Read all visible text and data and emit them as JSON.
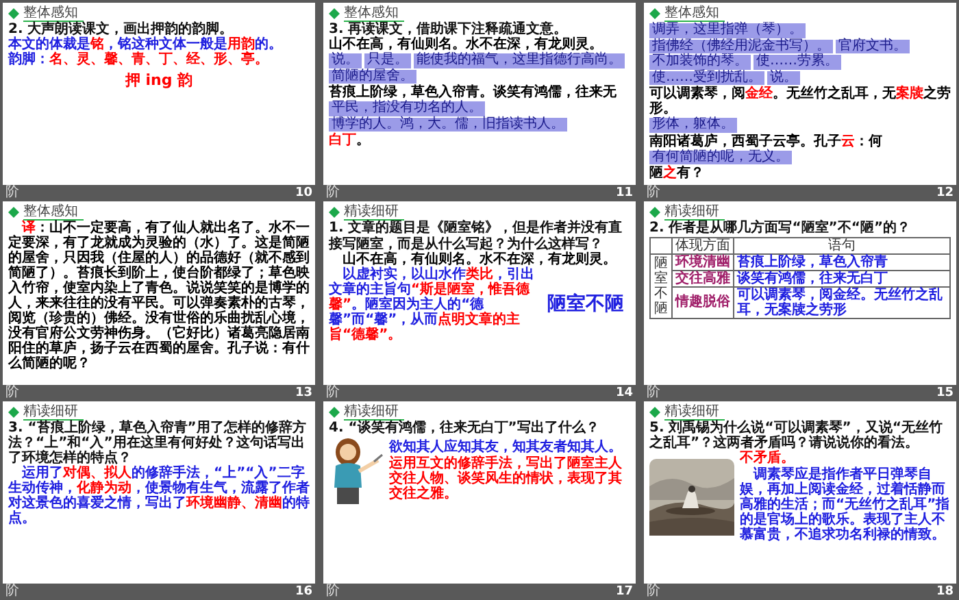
{
  "slides": [
    {
      "number": "10",
      "mark": "阶",
      "section": "整体感知",
      "blocks": [
        {
          "kind": "heading",
          "text": "2. 大声朗读课文，画出押韵的韵脚。"
        },
        {
          "kind": "para",
          "segments": [
            {
              "text": "本文的体裁是",
              "color": "#2020e0"
            },
            {
              "text": "铭",
              "color": "#ff0000"
            },
            {
              "text": "，铭这种文体一般是",
              "color": "#2020e0"
            },
            {
              "text": "用韵",
              "color": "#ff0000"
            },
            {
              "text": "的。",
              "color": "#2020e0"
            }
          ]
        },
        {
          "kind": "para",
          "segments": [
            {
              "text": "韵脚：",
              "color": "#2020e0"
            },
            {
              "text": "名、灵、馨、青、丁、经、形、亭。",
              "color": "#ff0000"
            }
          ]
        },
        {
          "kind": "callout",
          "text": "押 ing 韵",
          "color": "#ff0000"
        }
      ]
    },
    {
      "number": "11",
      "mark": "阶",
      "section": "整体感知",
      "blocks": [
        {
          "kind": "heading",
          "text": "3. 再读课文，借助课下注释疏通文意。"
        },
        {
          "kind": "para",
          "segments": [
            {
              "text": "山不在高，有仙则名。水不在深，有龙则灵。",
              "color": "#000000"
            }
          ]
        },
        {
          "kind": "tags",
          "items": [
            "说。",
            "只是。",
            "能使我的福气，这里指德行高尚。",
            "简陋的屋舍。"
          ]
        },
        {
          "kind": "para",
          "segments": [
            {
              "text": "苔痕上阶绿，草色入帘青。谈笑有鸿儒，往来无",
              "color": "#000000"
            }
          ]
        },
        {
          "kind": "tags",
          "items": [
            "平民，指没有功名的人。",
            "博学的人。鸿，大。儒，旧指读书人。"
          ]
        },
        {
          "kind": "para",
          "segments": [
            {
              "text": "白丁",
              "color": "#ff0000"
            },
            {
              "text": "。",
              "color": "#000000"
            }
          ]
        }
      ]
    },
    {
      "number": "12",
      "mark": "阶",
      "section": "整体感知",
      "blocks": [
        {
          "kind": "tags",
          "items": [
            "调弄，这里指弹（琴）。",
            "指佛经（佛经用泥金书写）。",
            "官府文书。",
            "不加装饰的琴。",
            "使……劳累。",
            "使……受到扰乱。",
            "说。"
          ]
        },
        {
          "kind": "para",
          "segments": [
            {
              "text": "可以调素琴，阅",
              "color": "#000000"
            },
            {
              "text": "金经",
              "color": "#ff0000"
            },
            {
              "text": "。无丝竹之乱耳，无",
              "color": "#000000"
            },
            {
              "text": "案牍",
              "color": "#ff0000"
            },
            {
              "text": "之劳形。",
              "color": "#000000"
            }
          ]
        },
        {
          "kind": "tags",
          "items": [
            "形体，躯体。"
          ]
        },
        {
          "kind": "para",
          "segments": [
            {
              "text": "南阳诸葛庐，西蜀子云亭。孔子",
              "color": "#000000"
            },
            {
              "text": "云",
              "color": "#ff0000"
            },
            {
              "text": "：何",
              "color": "#000000"
            }
          ]
        },
        {
          "kind": "tags",
          "items": [
            "有何简陋的呢，无义。"
          ]
        },
        {
          "kind": "para",
          "segments": [
            {
              "text": "陋",
              "color": "#000000"
            },
            {
              "text": "之",
              "color": "#ff0000"
            },
            {
              "text": "有？",
              "color": "#000000"
            }
          ]
        }
      ]
    },
    {
      "number": "13",
      "mark": "阶",
      "section": "整体感知",
      "blocks": [
        {
          "kind": "para",
          "indent": true,
          "segments": [
            {
              "text": "译",
              "color": "#ff0000"
            },
            {
              "text": "：山不一定要高，有了仙人就出名了。水不一定要深，有了龙就成为灵验的（水）了。这是简陋的屋舍，只因我（住屋的人）的品德好（就不感到简陋了）。苔痕长到阶上，使台阶都绿了；草色映入竹帘，使室内染上了青色。说说笑笑的是博学的人，来来往往的没有平民。可以弹奏素朴的古琴，阅览（珍贵的）佛经。没有世俗的乐曲扰乱心境，没有官府公文劳神伤身。（它好比）诸葛亮隐居南阳住的草庐，扬子云在西蜀的屋舍。孔子说：有什么简陋的呢？",
              "color": "#000000"
            }
          ]
        }
      ]
    },
    {
      "number": "14",
      "mark": "阶",
      "section": "精读细研",
      "blocks": [
        {
          "kind": "heading",
          "text": "1. 文章的题目是《陋室铭》，但是作者并没有直接写陋室，而是从什么写起？为什么这样写？"
        },
        {
          "kind": "para",
          "indent": true,
          "segments": [
            {
              "text": "山不在高，有仙则名。水不在深，有龙则灵。",
              "color": "#000000"
            }
          ]
        },
        {
          "kind": "columns",
          "left": [
            {
              "kind": "para",
              "indent": true,
              "segments": [
                {
                  "text": "以虚衬实，以山水作",
                  "color": "#2020e0"
                },
                {
                  "text": "类比",
                  "color": "#ff0000"
                },
                {
                  "text": "，引出文章的主旨句",
                  "color": "#2020e0"
                },
                {
                  "text": "“斯是陋室，惟吾德馨”",
                  "color": "#ff0000"
                },
                {
                  "text": "。陋室因为主人的“德馨”而“馨”，从而",
                  "color": "#2020e0"
                },
                {
                  "text": "点明文章的主旨“德馨”。",
                  "color": "#ff0000"
                }
              ]
            }
          ],
          "right": [
            {
              "kind": "callout",
              "text": "陋室不陋",
              "color": "#2020e0"
            }
          ]
        }
      ]
    },
    {
      "number": "15",
      "mark": "阶",
      "section": "精读细研",
      "blocks": [
        {
          "kind": "heading",
          "text": "2. 作者是从哪几方面写“陋室”不“陋”的？"
        },
        {
          "kind": "table",
          "columns": [
            "体现方面",
            "语句"
          ],
          "side": "陋室不陋",
          "rows": [
            [
              "环境清幽",
              "苔痕上阶绿，草色入帘青"
            ],
            [
              "交往高雅",
              "谈笑有鸿儒，往来无白丁"
            ],
            [
              "情趣脱俗",
              "可以调素琴，阅金经。无丝竹之乱耳，无案牍之劳形"
            ]
          ]
        }
      ]
    },
    {
      "number": "16",
      "mark": "阶",
      "section": "精读细研",
      "blocks": [
        {
          "kind": "heading",
          "text": "3. “苔痕上阶绿，草色入帘青”用了怎样的修辞方法？“上”和“入”用在这里有何好处？这句话写出了环境怎样的特点？"
        },
        {
          "kind": "para",
          "indent": true,
          "segments": [
            {
              "text": "运用了",
              "color": "#2020e0"
            },
            {
              "text": "对偶、拟人",
              "color": "#ff0000"
            },
            {
              "text": "的修辞手法，“上”“入”二字生动传神，",
              "color": "#2020e0"
            },
            {
              "text": "化静为动",
              "color": "#ff0000"
            },
            {
              "text": "，使景物有生气，流露了作者对这景色的喜爱之情，写出了",
              "color": "#2020e0"
            },
            {
              "text": "环境幽静、清幽",
              "color": "#ff0000"
            },
            {
              "text": "的特点。",
              "color": "#2020e0"
            }
          ]
        }
      ]
    },
    {
      "number": "17",
      "mark": "阶",
      "section": "精读细研",
      "blocks": [
        {
          "kind": "heading",
          "text": "4. “谈笑有鸿儒，往来无白丁”写出了什么？"
        },
        {
          "kind": "columns",
          "left": [
            {
              "kind": "figure"
            }
          ],
          "right": [
            {
              "kind": "para",
              "segments": [
                {
                  "text": "欲知其人应知其友，知其友者知其人。",
                  "color": "#2020e0"
                }
              ]
            },
            {
              "kind": "para",
              "segments": [
                {
                  "text": "运用互文的修辞手法，写出了陋室主人交往人物、谈笑风生的情状，表现了其交往之雅。",
                  "color": "#ff0000"
                }
              ]
            }
          ]
        }
      ]
    },
    {
      "number": "18",
      "mark": "阶",
      "section": "精读细研",
      "blocks": [
        {
          "kind": "heading",
          "text": "5. 刘禹锡为什么说“可以调素琴”，又说“无丝竹之乱耳”？这两者矛盾吗？请说说你的看法。"
        },
        {
          "kind": "columns",
          "left": [
            {
              "kind": "picture"
            }
          ],
          "right": [
            {
              "kind": "para",
              "segments": [
                {
                  "text": "不矛盾。",
                  "color": "#ff0000"
                }
              ]
            },
            {
              "kind": "para",
              "indent": true,
              "segments": [
                {
                  "text": "调素琴应是指作者平日弹琴自娱，再加上阅读金经，过着恬静而高雅的生活；而“无丝竹之乱耳”指的是官场上的歌乐。表现了主人不慕富贵，不追求功名利禄的情致。",
                  "color": "#2020e0"
                }
              ]
            }
          ]
        }
      ]
    }
  ]
}
